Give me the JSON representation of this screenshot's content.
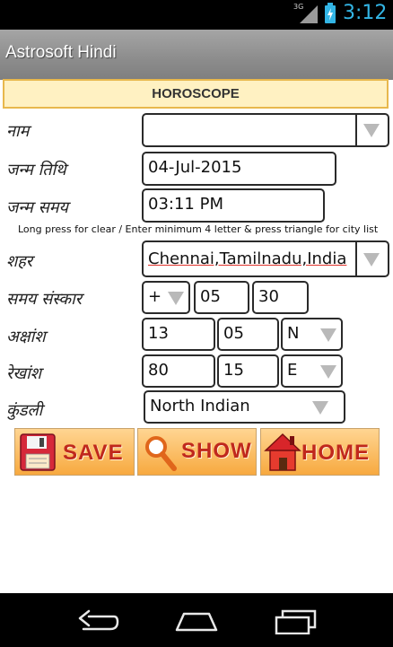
{
  "status": {
    "network": "3G",
    "time": "3:12"
  },
  "app": {
    "title": "Astrosoft Hindi"
  },
  "header": "HOROSCOPE",
  "form": {
    "name": {
      "label": "नाम",
      "value": ""
    },
    "dob": {
      "label": "जन्म तिथि",
      "value": "04-Jul-2015"
    },
    "tob": {
      "label": "जन्म समय",
      "value": "03:11 PM"
    },
    "hint": "Long press for clear / Enter minimum 4 letter & press triangle for city list",
    "city": {
      "label": "शहर",
      "value": "Chennai,Tamilnadu,India"
    },
    "tz": {
      "label": "समय संस्कार",
      "sign": "+",
      "hours": "05",
      "minutes": "30"
    },
    "lat": {
      "label": "अक्षांश",
      "deg": "13",
      "min": "05",
      "dir": "N"
    },
    "lon": {
      "label": "रेखांश",
      "deg": "80",
      "min": "15",
      "dir": "E"
    },
    "chart": {
      "label": "कुंडली",
      "value": "North Indian"
    }
  },
  "buttons": {
    "save": "SAVE",
    "show": "SHOW",
    "home": "HOME"
  },
  "colors": {
    "accent": "#33b5e5",
    "header_bg": "#fff1c2",
    "header_border": "#e8b84d",
    "button_text": "#c0281d"
  }
}
